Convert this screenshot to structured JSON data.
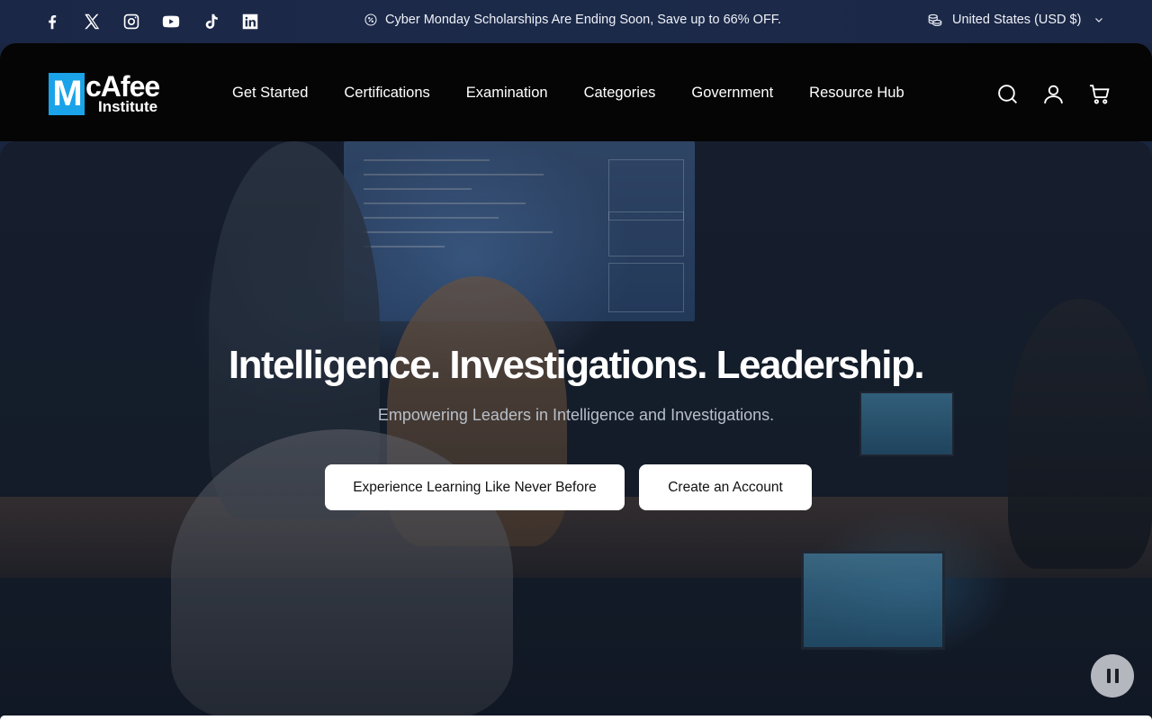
{
  "topbar": {
    "socials": [
      {
        "icon": "facebook-icon"
      },
      {
        "icon": "x-twitter-icon"
      },
      {
        "icon": "instagram-icon"
      },
      {
        "icon": "youtube-icon"
      },
      {
        "icon": "tiktok-icon"
      },
      {
        "icon": "linkedin-icon"
      }
    ],
    "promo_text": "Cyber Monday Scholarships Are Ending Soon, Save up to 66% OFF.",
    "currency_label": "United States (USD $)"
  },
  "header": {
    "logo": {
      "letter": "M",
      "word1": "cAfee",
      "word2": "Institute"
    },
    "nav": [
      {
        "label": "Get Started"
      },
      {
        "label": "Certifications"
      },
      {
        "label": "Examination"
      },
      {
        "label": "Categories"
      },
      {
        "label": "Government"
      },
      {
        "label": "Resource Hub"
      }
    ]
  },
  "hero": {
    "title": "Intelligence. Investigations. Leadership.",
    "subtitle": "Empowering Leaders in Intelligence and Investigations.",
    "cta_primary": "Experience Learning Like Never Before",
    "cta_secondary": "Create an Account"
  },
  "colors": {
    "topbar_bg": "#1b2746",
    "header_bg": "#050505",
    "logo_blue": "#1aa3e8",
    "button_bg": "#ffffff"
  }
}
